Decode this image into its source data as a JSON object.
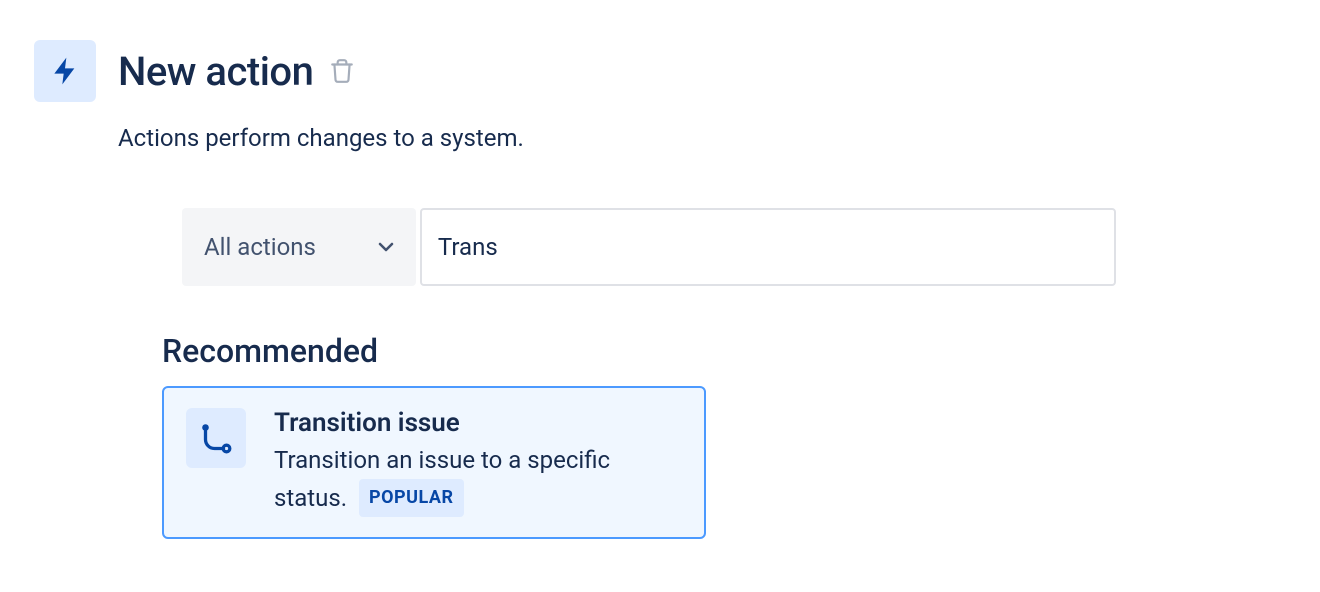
{
  "header": {
    "title": "New action",
    "subtitle": "Actions perform changes to a system."
  },
  "filter": {
    "dropdown_label": "All actions",
    "search_value": "Trans"
  },
  "recommended": {
    "section_title": "Recommended",
    "card": {
      "title": "Transition issue",
      "description": "Transition an issue to a specific status.",
      "badge": "POPULAR"
    }
  }
}
